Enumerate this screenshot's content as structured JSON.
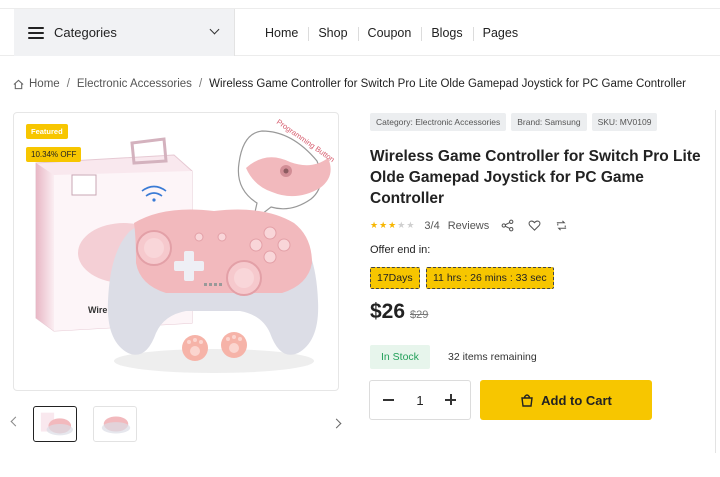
{
  "header": {
    "categories_label": "Categories",
    "categories_icon": "menu-icon",
    "nav": [
      "Home",
      "Shop",
      "Coupon",
      "Blogs",
      "Pages"
    ]
  },
  "breadcrumb": {
    "icon": "home-icon",
    "items": [
      "Home",
      "Electronic Accessories",
      "Wireless Game Controller for Switch Pro Lite Olde Gamepad Joystick for PC Game Controller"
    ]
  },
  "gallery": {
    "featured_badge": "Featured",
    "discount_badge": "10.34% OFF",
    "box_label": "Wirele",
    "callout_text": "Programming Button",
    "thumbnail_count": 2
  },
  "product": {
    "tags": [
      "Category: Electronic Accessories",
      "Brand: Samsung",
      "SKU: MV0109"
    ],
    "title": "Wireless Game Controller for Switch Pro Lite Olde Gamepad Joystick for PC Game Controller",
    "rating": 3,
    "rating_max": 5,
    "rating_text": "3/4",
    "reviews_label": "Reviews",
    "offer_label": "Offer end in:",
    "timer_days": "17Days",
    "timer_time": "11 hrs : 26 mins : 33 sec",
    "price": "$26",
    "old_price": "$29",
    "stock_label": "In Stock",
    "remaining": "32 items remaining",
    "quantity": "1",
    "add_to_cart": "Add to Cart"
  },
  "colors": {
    "accent": "#f7c600",
    "stock_green": "#22a05a",
    "stock_bg": "#e7f5ec",
    "controller_pink": "#f2b9bd",
    "controller_grey": "#dcdde6"
  }
}
